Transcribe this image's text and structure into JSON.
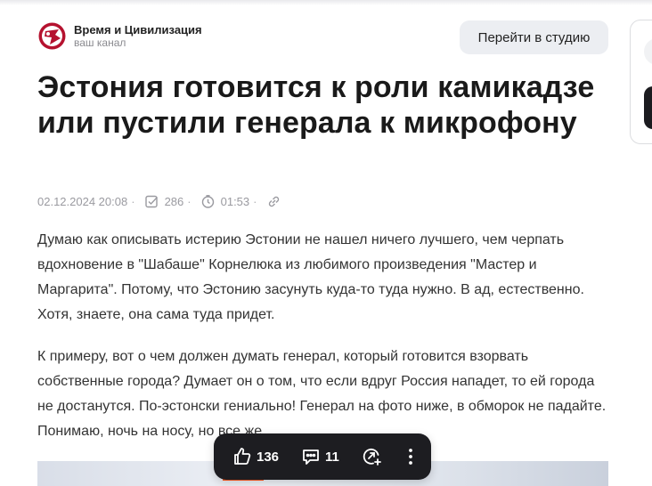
{
  "channel": {
    "name": "Время и Цивилизация",
    "subtitle": "ваш канал"
  },
  "header": {
    "studio_button": "Перейти в студию"
  },
  "article": {
    "title": "Эстония готовится к роли камикадзе или пустили генерала к микрофону",
    "meta": {
      "date": "02.12.2024 20:08",
      "reads": "286",
      "read_time": "01:53",
      "separator": "·"
    },
    "paragraphs": [
      "Думаю как описывать истерию Эстонии не нашел ничего лучшего, чем черпать вдохновение в \"Шабаше\" Корнелюка из любимого произведения \"Мастер и Маргарита\". Потому, что Эстонию засунуть куда-то туда нужно. В ад, естественно. Хотя, знаете, она сама туда придет.",
      "К примеру, вот о чем должен думать генерал, который готовится взорвать собственные города? Думает он о том, что если вдруг Россия нападет, то ей города не достанутся. По-эстонски гениально! Генерал на фото ниже, в обморок не падайте. Понимаю, ночь на носу, но все же."
    ]
  },
  "actions": {
    "likes": "136",
    "comments": "11"
  },
  "icons": {
    "meta_reads": "checkbox-icon",
    "meta_time": "clock-icon",
    "meta_link": "link-icon",
    "like": "thumbs-up-icon",
    "comment": "comment-icon",
    "repost": "repost-icon",
    "more": "more-vertical-icon"
  },
  "colors": {
    "accent": "#ff5a1f",
    "avatar": "#b5122f",
    "bar": "#1d1d21"
  }
}
